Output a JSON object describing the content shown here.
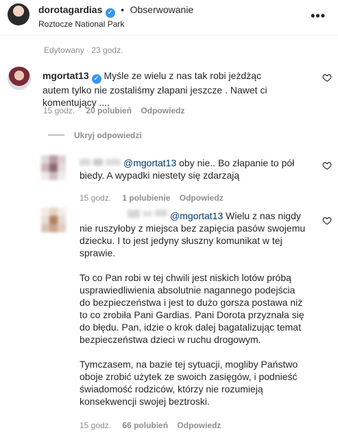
{
  "header": {
    "username": "dorotagardias",
    "verified_glyph": "✓",
    "separator": "•",
    "follow_label": "Obserwowanie",
    "location": "Roztocze National Park",
    "more_icon": "more-horizontal-icon"
  },
  "caption_meta": {
    "edited": "Edytowany · 23 godz."
  },
  "comment_main": {
    "username": "mgortat13",
    "verified_glyph": "✓",
    "text": "Myśle ze wielu z nas tak robi jeżdżąc autem tylko nie zostaliśmy złapani jeszcze . Nawet ci komentujący ....",
    "time": "15 godz.",
    "likes": "20 polubień",
    "reply": "Odpowiedz",
    "hide_replies": "Ukryj odpowiedzi"
  },
  "reply_1": {
    "mention": "@mgortat13",
    "text": " oby nie.. Bo złapanie to pół biedy. A wypadki niestety się zdarzają",
    "time": "15 godz.",
    "likes": "1 polubienie",
    "reply": "Odpowiedz"
  },
  "reply_2": {
    "mention": "@mgortat13",
    "p1": " Wielu z nas nigdy nie ruszyłoby z miejsca bez zapięcia pasów swojemu dziecku. I to jest jedyny słuszny komunikat w tej sprawie.",
    "p2": "To co Pan robi w tej chwili jest niskich lotów próbą usprawiedliwienia absolutnie nagannego podejścia do bezpieczeństwa i jest to dużo gorsza postawa niż to co zrobiła Pani Gardias. Pani Dorota przyznała się do błędu. Pan, idzie o krok dalej bagatalizując temat bezpieczeństwa dzieci w ruchu drogowym.",
    "p3": "Tymczasem, na bazie tej sytuacji, mogliby Państwo oboje zrobić użytek ze swoich zasięgów, i podnieść świadomość rodziców, którzy nie rozumieją konsekwencji swojej beztroski.",
    "time": "15 godz.",
    "likes": "66 polubień",
    "reply": "Odpowiedz"
  },
  "colors": {
    "link": "#00376b",
    "muted": "#8e8e8e",
    "verified": "#3897f0"
  }
}
